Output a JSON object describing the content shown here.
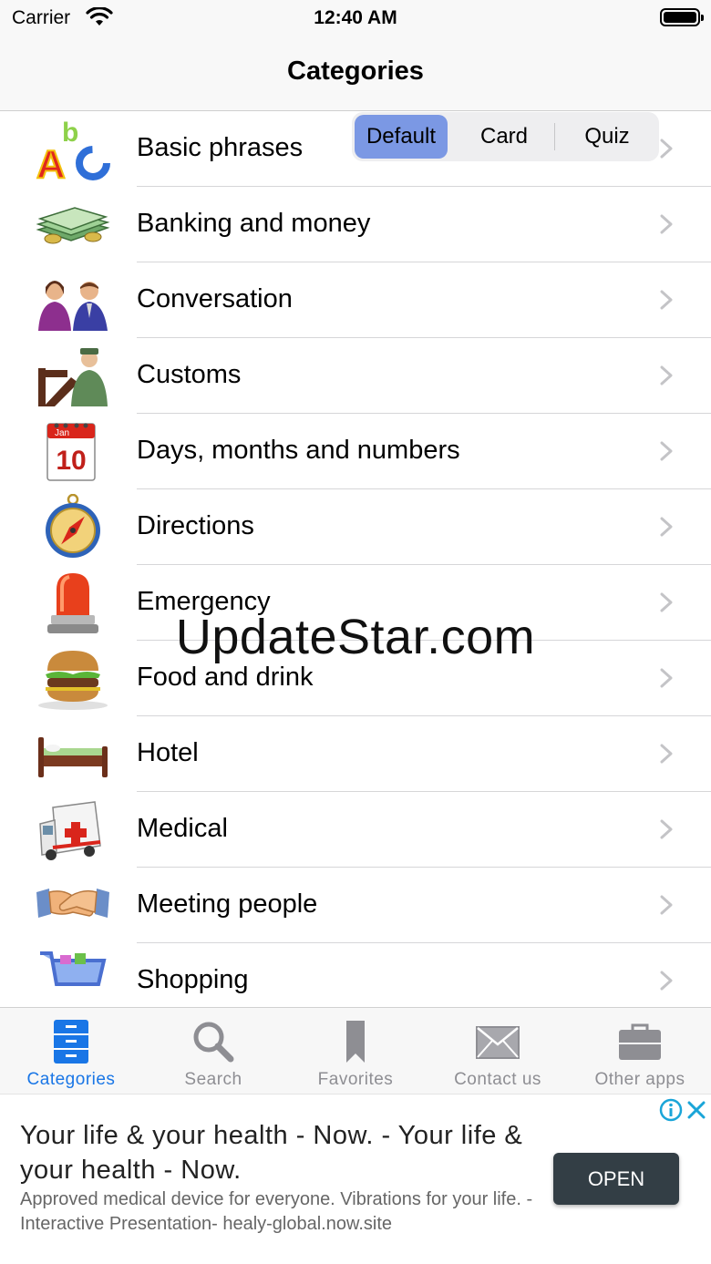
{
  "status_bar": {
    "carrier": "Carrier",
    "time": "12:40 AM"
  },
  "nav": {
    "title": "Categories"
  },
  "segmented": {
    "options": [
      "Default",
      "Card",
      "Quiz"
    ],
    "selected": "Default"
  },
  "categories": [
    {
      "label": "Basic phrases",
      "icon": "abc-letters-icon"
    },
    {
      "label": "Banking and money",
      "icon": "money-stack-icon"
    },
    {
      "label": "Conversation",
      "icon": "people-talking-icon"
    },
    {
      "label": "Customs",
      "icon": "customs-officer-icon"
    },
    {
      "label": "Days, months and numbers",
      "icon": "calendar-icon"
    },
    {
      "label": "Directions",
      "icon": "compass-icon"
    },
    {
      "label": "Emergency",
      "icon": "siren-light-icon"
    },
    {
      "label": "Food and drink",
      "icon": "burger-icon"
    },
    {
      "label": "Hotel",
      "icon": "bed-icon"
    },
    {
      "label": "Medical",
      "icon": "ambulance-icon"
    },
    {
      "label": "Meeting people",
      "icon": "handshake-icon"
    },
    {
      "label": "Shopping",
      "icon": "shopping-cart-icon"
    }
  ],
  "calendar_icon": {
    "month": "Jan",
    "day": "10"
  },
  "watermark": "UpdateStar.com",
  "tabs": [
    {
      "label": "Categories",
      "icon": "categories-icon",
      "active": true
    },
    {
      "label": "Search",
      "icon": "search-icon",
      "active": false
    },
    {
      "label": "Favorites",
      "icon": "bookmark-icon",
      "active": false
    },
    {
      "label": "Contact us",
      "icon": "envelope-icon",
      "active": false
    },
    {
      "label": "Other apps",
      "icon": "briefcase-icon",
      "active": false
    }
  ],
  "ad": {
    "title": "Your life & your health - Now. - Your life & your health - Now.",
    "description": "Approved medical device for everyone. Vibrations for your life. -Interactive Presentation- healy-global.now.site",
    "button": "OPEN"
  },
  "colors": {
    "accent": "#1976e6",
    "segment_selected": "#7b98e4",
    "ad_button": "#333e45"
  }
}
